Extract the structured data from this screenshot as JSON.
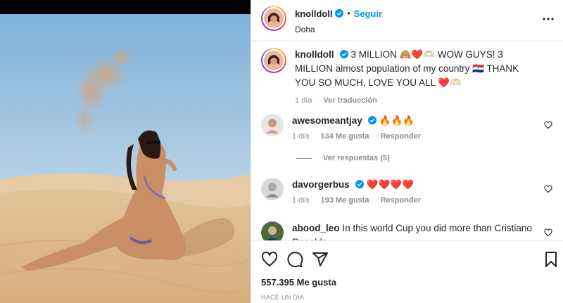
{
  "header": {
    "username": "knolldoll",
    "follow_label": "Seguir",
    "location": "Doha"
  },
  "caption": {
    "username": "knolldoll",
    "text": "3 MILLION 🙈❤️🫶🏻 WOW GUYS! 3 MILLION almost population of my country 🇵🇾 THANK YOU SO MUCH, LOVE YOU ALL ❤️🫶🏻",
    "age": "1 día",
    "translate_label": "Ver traducción"
  },
  "comments": [
    {
      "username": "awesomeantjay",
      "text": "🔥🔥🔥",
      "age": "1 día",
      "likes": "134 Me gusta",
      "reply_label": "Responder"
    },
    {
      "username": "davorgerbus",
      "text": "❤️❤️❤️❤️",
      "age": "1 día",
      "likes": "193 Me gusta",
      "reply_label": "Responder"
    },
    {
      "username": "abood_leo",
      "text": "In this world Cup you did more than Cristiano Ronaldo"
    }
  ],
  "replies_label": "Ver respuestas (5)",
  "likes_count": "557.395 Me gusta",
  "posted_ago": "HACE UN DÍA",
  "icons": {
    "more": "more-horizontal-icon",
    "like": "heart-icon",
    "comment": "comment-icon",
    "share": "share-icon",
    "save": "bookmark-icon",
    "verified": "verified-badge-icon"
  },
  "colors": {
    "accent": "#0095f6",
    "secondary_text": "#8e8e8e",
    "border": "#efefef"
  }
}
